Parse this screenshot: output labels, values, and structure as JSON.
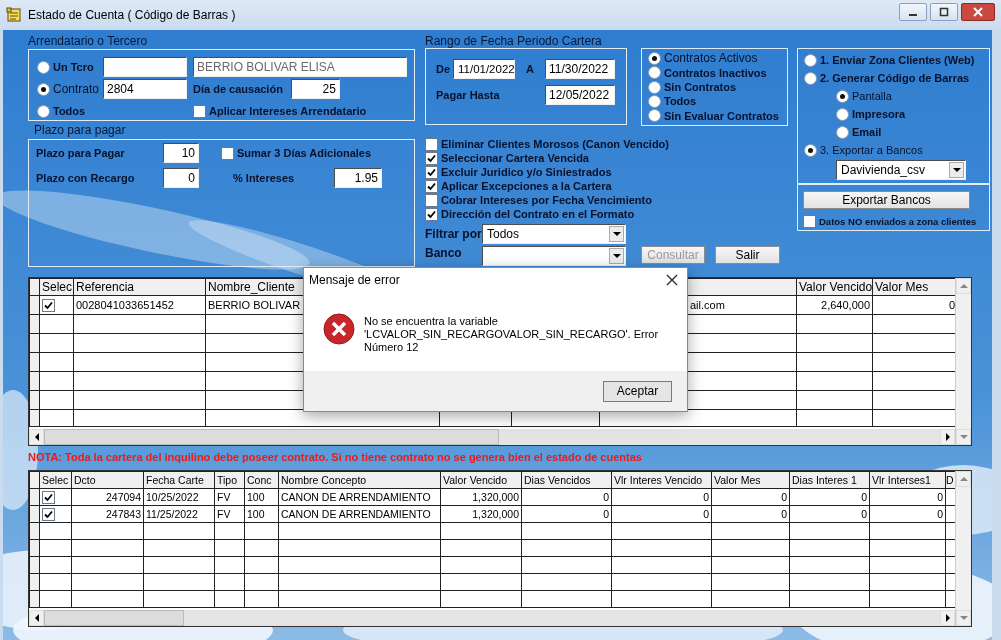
{
  "window": {
    "title": "Estado de Cuenta ( Código de Barras )"
  },
  "arrendatario": {
    "label": "Arrendatario o Tercero",
    "options": [
      {
        "label": "Un Tcro",
        "selected": false
      },
      {
        "label": "Contrato",
        "selected": true
      },
      {
        "label": "Todos",
        "selected": false
      }
    ],
    "contract_value": "2804",
    "name_value": "BERRIO BOLIVAR ELISA",
    "dia_label": "Día de causación",
    "dia_value": "25",
    "aplicar": {
      "label": "Aplicar Intereses Arrendatario",
      "checked": false
    }
  },
  "plazo": {
    "label": "Plazo para pagar",
    "pagar_label": "Plazo para Pagar",
    "pagar_value": "10",
    "recargo_label": "Plazo con Recargo",
    "recargo_value": "0",
    "sumar": {
      "label": "Sumar 3 Días Adicionales",
      "checked": false
    },
    "intereses_label": "% Intereses",
    "intereses_value": "1.95"
  },
  "fechas": {
    "label": "Rango de Fecha Periodo Cartera",
    "de_label": "De",
    "de_value": "11/01/2022",
    "a_label": "A",
    "a_value": "11/30/2022",
    "hasta_label": "Pagar Hasta",
    "hasta_value": "12/05/2022"
  },
  "contratos": [
    {
      "label": "Contratos Activos",
      "selected": true
    },
    {
      "label": "Contratos Inactivos",
      "selected": false
    },
    {
      "label": "Sin Contratos",
      "selected": false
    },
    {
      "label": "Todos",
      "selected": false
    },
    {
      "label": "Sin Evaluar Contratos",
      "selected": false
    }
  ],
  "opciones": [
    {
      "label": "Eliminar Clientes Morosos (Canon Vencido)",
      "checked": false
    },
    {
      "label": "Seleccionar Cartera Vencida",
      "checked": true
    },
    {
      "label": "Excluir Juridico y/o Siniestrados",
      "checked": true
    },
    {
      "label": "Aplicar Excepciones a la Cartera",
      "checked": true
    },
    {
      "label": "Cobrar Intereses por Fecha Vencimiento",
      "checked": false
    },
    {
      "label": "Dirección del Contrato en el Formato",
      "checked": true
    }
  ],
  "filtrar": {
    "label": "Filtrar por",
    "value": "Todos"
  },
  "banco": {
    "label": "Banco"
  },
  "buttons": [
    {
      "label": "Consultar",
      "disabled": true
    },
    {
      "label": "Salir",
      "disabled": false
    }
  ],
  "salida": {
    "options": [
      {
        "label": "1. Enviar Zona Clientes (Web)",
        "selected": false
      },
      {
        "label": "2. Generar Código de Barras",
        "selected": false,
        "children": [
          {
            "label": "Pantalla",
            "selected": true
          },
          {
            "label": "Impresora",
            "selected": false
          },
          {
            "label": "Email",
            "selected": false
          }
        ]
      },
      {
        "label": "3. Exportar a Bancos",
        "selected": true
      }
    ],
    "banco_value": "Davivienda_csv",
    "export_button": "Exportar Bancos",
    "no_enviados": {
      "label": "Datos NO enviados a zona clientes",
      "checked": false
    }
  },
  "table1": {
    "selec_header": "Selec",
    "columns": [
      "Referencia",
      "Nombre_Cliente",
      "Valor Vencido",
      "Valor Mes"
    ],
    "rows": [
      {
        "checked": true,
        "referencia": "0028041033651452",
        "nombre": "BERRIO BOLIVAR",
        "column_6": "ail.com",
        "valor_vencido": "2,640,000",
        "valor_mes": "0"
      }
    ]
  },
  "note": "NOTA: Toda la cartera del inquilino debe poseer contrato. Si no tiene contrato no se genera bien el estado de cuentas",
  "table2": {
    "selec_header": "Selec",
    "columns": [
      "Dcto",
      "Fecha Carte",
      "Tipo",
      "Conc",
      "Nombre Concepto",
      "Valor Vencido",
      "Dias Vencidos",
      "Vlr Interes Vencido",
      "Valor Mes",
      "Dias Interes 1",
      "Vlr Interses1",
      "D"
    ],
    "rows": [
      {
        "checked": true,
        "cells": [
          "247094",
          "10/25/2022",
          "FV",
          "100",
          "CANON DE ARRENDAMIENTO",
          "1,320,000",
          "0",
          "0",
          "0",
          "0",
          "0"
        ]
      },
      {
        "checked": true,
        "cells": [
          "247843",
          "11/25/2022",
          "FV",
          "100",
          "CANON DE ARRENDAMIENTO",
          "1,320,000",
          "0",
          "0",
          "0",
          "0",
          "0"
        ]
      }
    ]
  },
  "dialog": {
    "title": "Mensaje de error",
    "message": "No se encuentra la variable 'LCVALOR_SIN_RECARGOVALOR_SIN_RECARGO'. Error Número 12",
    "button": "Aceptar"
  }
}
